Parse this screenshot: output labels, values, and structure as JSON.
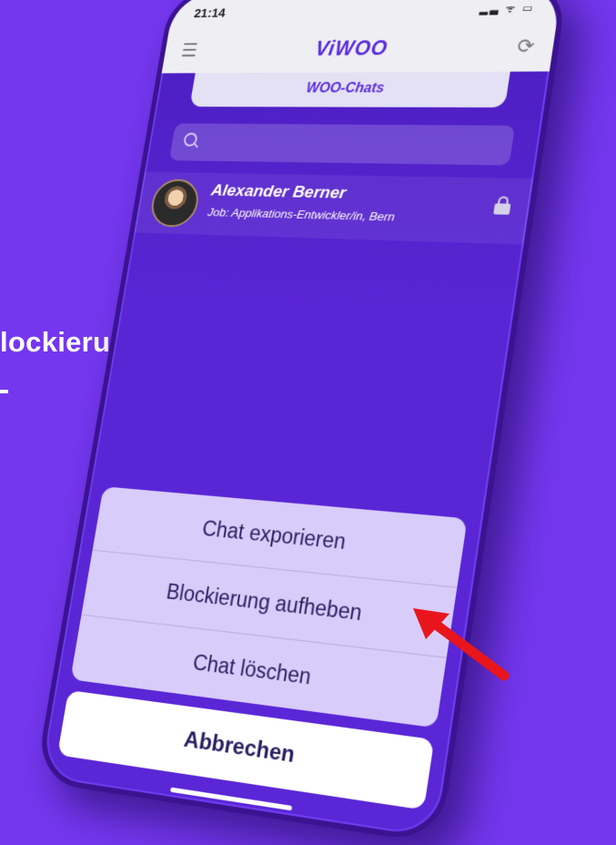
{
  "background_text": "lockierung",
  "status_bar": {
    "time": "21:14",
    "icons": "▂▃ ᯤ ▭"
  },
  "header": {
    "brand": "ViWOO",
    "tab": "WOO-Chats"
  },
  "search": {
    "placeholder": ""
  },
  "chat": {
    "name": "Alexander Berner",
    "subtitle": "Job: Applikations-Entwickler/in, Bern"
  },
  "action_sheet": {
    "items": [
      "Chat exporieren",
      "Blockierung aufheben",
      "Chat löschen"
    ],
    "cancel": "Abbrechen"
  },
  "colors": {
    "background": "#7436ef",
    "brand": "#5b2be0",
    "sheet": "#d8ccfb",
    "arrow": "#e8161c"
  },
  "icons": {
    "menu": "hamburger-icon",
    "refresh": "refresh-icon",
    "search": "search-icon",
    "lock": "lock-icon",
    "arrow": "red-arrow-icon"
  }
}
